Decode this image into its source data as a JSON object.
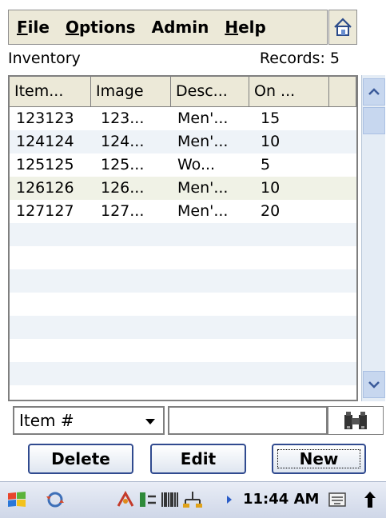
{
  "menu": {
    "items": [
      {
        "u": "F",
        "rest": "ile"
      },
      {
        "u": "O",
        "rest": "ptions"
      },
      {
        "u": "",
        "rest": "Admin"
      },
      {
        "u": "H",
        "rest": "elp"
      }
    ],
    "home_icon": "home-icon"
  },
  "header": {
    "title": "Inventory",
    "records_label": "Records:",
    "records_value": "5"
  },
  "grid": {
    "columns": [
      "Item...",
      "Image",
      "Desc...",
      "On ..."
    ],
    "rows": [
      [
        "123123",
        "123...",
        "Men'...",
        "15"
      ],
      [
        "124124",
        "124...",
        "Men'...",
        "10"
      ],
      [
        "125125",
        "125...",
        "Wo...",
        "5"
      ],
      [
        "126126",
        "126...",
        "Men'...",
        "10"
      ],
      [
        "127127",
        "127...",
        "Men'...",
        "20"
      ]
    ]
  },
  "search": {
    "field": "Item #",
    "value": "",
    "find_icon": "binoculars-icon"
  },
  "buttons": {
    "delete": "Delete",
    "edit": "Edit",
    "new": "New"
  },
  "taskbar": {
    "time": "11:44 AM"
  },
  "colors": {
    "accent": "#304a8f",
    "menubar": "#ece9d8",
    "row_alt": "#eef3f8",
    "scroll": "#c7d7ef"
  }
}
